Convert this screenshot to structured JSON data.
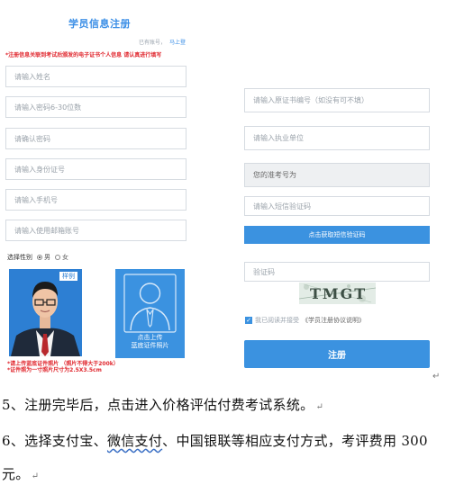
{
  "form": {
    "title": "学员信息注册",
    "have_account": "已有账号，",
    "login_link": "马上登",
    "notice": "*注册信息关联到考试后颁发的电子证书个人信息 请认真进行填写",
    "left_fields": [
      {
        "placeholder": "请输入姓名"
      },
      {
        "placeholder": "请输入密码6-30位数"
      },
      {
        "placeholder": "请确认密码"
      },
      {
        "placeholder": "请输入身份证号"
      },
      {
        "placeholder": "请输入手机号"
      },
      {
        "placeholder": "请输入使用邮箱账号"
      }
    ],
    "right_fields": {
      "cert_no": "请输入原证书编号（如没有可不填）",
      "company": "请输入执业单位",
      "exam_no": "您的准考号为",
      "sms_code": "请输入短信验证码",
      "captcha": "验证码"
    },
    "gender": {
      "label": "选择性别",
      "male": "男",
      "female": "女",
      "selected": "male"
    },
    "photo_sample_tag": "样例",
    "upload_lines": [
      "点击上传",
      "蓝底证件照片"
    ],
    "photo_notes": [
      "*请上传蓝底证件照片 （照片不得大于200k）",
      "*证件照为一寸照片尺寸为2.5X3.5cm"
    ],
    "sms_button": "点击获取短信验证码",
    "captcha_text": "TMGT",
    "agree_prefix": "我已阅读并接受",
    "agree_link": "《学员注册协议说明》",
    "agree_checked": true,
    "register_button": "注册"
  },
  "document": {
    "line5": "5、注册完毕后，点击进入价格评估付费考试系统。",
    "line6_a": "6、选择支付宝、",
    "line6_b": "微信支付",
    "line6_c": "、中国银联等相应支付方式，考评费用 300",
    "line7": "元。",
    "return_mark": "↵"
  },
  "colors": {
    "accent": "#3b92e0",
    "warning": "#e0262d",
    "title": "#3a8ee6"
  }
}
